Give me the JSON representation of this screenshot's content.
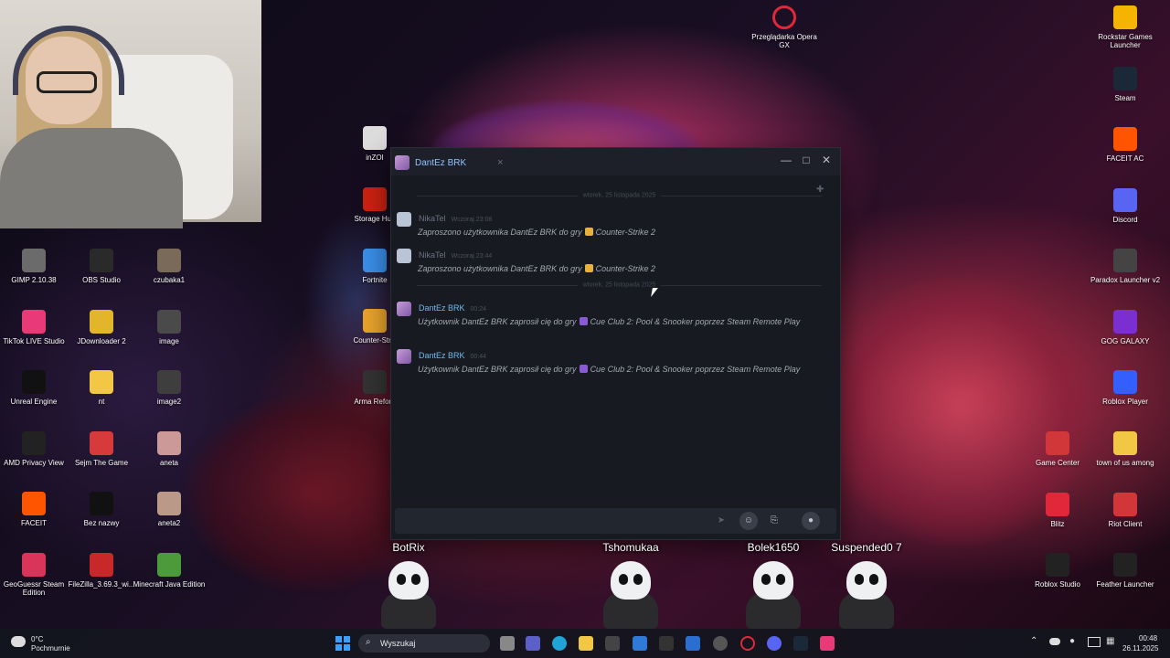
{
  "desktop": {
    "left_icons": [
      {
        "label": "GIMP 2.10.38",
        "icon": "gimp-icon",
        "color": "#6b6b6b"
      },
      {
        "label": "OBS Studio",
        "icon": "obs-icon",
        "color": "#2a2a2a"
      },
      {
        "label": "czubaka1",
        "icon": "image-file-icon",
        "color": "#7a6a5a"
      },
      {
        "label": "TikTok LIVE Studio",
        "icon": "tiktok-icon",
        "color": "#e83a76"
      },
      {
        "label": "JDownloader 2",
        "icon": "jdownloader-icon",
        "color": "#e2b62b"
      },
      {
        "label": "image",
        "icon": "image-file-icon",
        "color": "#4a4a4a"
      },
      {
        "label": "Unreal Engine",
        "icon": "unreal-icon",
        "color": "#111111"
      },
      {
        "label": "nt",
        "icon": "folder-icon",
        "color": "#f2c744"
      },
      {
        "label": "image2",
        "icon": "image-file-icon",
        "color": "#3e3e3e"
      },
      {
        "label": "AMD Privacy View",
        "icon": "amd-icon",
        "color": "#222222"
      },
      {
        "label": "Sejm The Game",
        "icon": "sejm-icon",
        "color": "#d63a3a"
      },
      {
        "label": "aneta",
        "icon": "image-file-icon",
        "color": "#c99"
      },
      {
        "label": "FACEIT",
        "icon": "faceit-icon",
        "color": "#ff5500"
      },
      {
        "label": "Bez nazwy",
        "icon": "image-file-icon",
        "color": "#111111"
      },
      {
        "label": "aneta2",
        "icon": "image-file-icon",
        "color": "#b98"
      },
      {
        "label": "GeoGuessr Steam Edition",
        "icon": "geoguessr-icon",
        "color": "#d9345a"
      },
      {
        "label": "FileZilla_3.69.3_wi...",
        "icon": "filezilla-icon",
        "color": "#c8282a"
      },
      {
        "label": "Minecraft Java Edition",
        "icon": "minecraft-icon",
        "color": "#4c9a3a"
      }
    ],
    "middle_icons": [
      {
        "label": "inZOI",
        "icon": "inzoi-icon",
        "color": "#ddd"
      },
      {
        "label": "Storage Hun",
        "icon": "storage-hunter-icon",
        "color": "#c21"
      },
      {
        "label": "Fortnite",
        "icon": "fortnite-icon",
        "color": "#3a8ee8"
      },
      {
        "label": "Counter-Strik",
        "icon": "cs-icon",
        "color": "#e8a42a"
      },
      {
        "label": "Arma Reforg",
        "icon": "arma-icon",
        "color": "#333"
      }
    ],
    "right_icons": [
      {
        "label": "Rockstar Games Launcher",
        "icon": "rockstar-icon",
        "color": "#f4b400"
      },
      {
        "label": "Steam",
        "icon": "steam-icon",
        "color": "#1b2838"
      },
      {
        "label": "FACEIT AC",
        "icon": "faceit-ac-icon",
        "color": "#ff5500"
      },
      {
        "label": "Discord",
        "icon": "discord-icon",
        "color": "#5865f2"
      },
      {
        "label": "Paradox Launcher v2",
        "icon": "paradox-icon",
        "color": "#444"
      },
      {
        "label": "GOG GALAXY",
        "icon": "gog-icon",
        "color": "#7b2fd0"
      },
      {
        "label": "Roblox Player",
        "icon": "roblox-icon",
        "color": "#335fff"
      },
      {
        "label": "town of us among",
        "icon": "folder-icon",
        "color": "#f2c744"
      },
      {
        "label": "Riot Client",
        "icon": "riot-icon",
        "color": "#d13639"
      },
      {
        "label": "Feather Launcher",
        "icon": "feather-icon",
        "color": "#222"
      }
    ],
    "right2_icons": [
      {
        "label": "Game Center",
        "icon": "game-center-icon",
        "color": "#d13639"
      },
      {
        "label": "Blitz",
        "icon": "blitz-icon",
        "color": "#e0283a"
      },
      {
        "label": "Roblox Studio",
        "icon": "roblox-studio-icon",
        "color": "#222"
      }
    ],
    "opera": {
      "label": "Przeglądarka Opera GX",
      "icon": "opera-gx-icon",
      "color": "#e0283a"
    }
  },
  "chat": {
    "tab_name": "DantEz BRK",
    "tab_close": "×",
    "window_buttons": [
      "—",
      "□",
      "✕"
    ],
    "date_divider_1": "wtorek, 25 listopada 2025",
    "date_divider_2": "wtorek, 25 listopada 2025",
    "messages": [
      {
        "sender": "NikaTel",
        "time": "Wczoraj 23:08",
        "text_pre": "Zaproszono użytkownika DantEz BRK do gry",
        "game": "Counter-Strike 2",
        "text_post": "",
        "name_color": "#6b7280",
        "game_color": "#e8b23a"
      },
      {
        "sender": "NikaTel",
        "time": "Wczoraj 23:44",
        "text_pre": "Zaproszono użytkownika DantEz BRK do gry",
        "game": "Counter-Strike 2",
        "text_post": "",
        "name_color": "#6b7280",
        "game_color": "#e8b23a"
      },
      {
        "sender": "DantEz BRK",
        "time": "00:24",
        "text_pre": "Użytkownik DantEz BRK zaprosił cię do gry",
        "game": "Cue Club 2: Pool & Snooker",
        "text_post": "poprzez Steam Remote Play",
        "name_color": "#6dbcf0",
        "game_color": "#8a5ad6"
      },
      {
        "sender": "DantEz BRK",
        "time": "00:44",
        "text_pre": "Użytkownik DantEz BRK zaprosił cię do gry",
        "game": "Cue Club 2: Pool & Snooker",
        "text_post": "poprzez Steam Remote Play",
        "name_color": "#6dbcf0",
        "game_color": "#8a5ad6"
      }
    ]
  },
  "overlay_players": [
    "BotRix",
    "Tshomukaa",
    "Bolek1650",
    "Suspended0 7"
  ],
  "taskbar": {
    "weather_temp": "0°C",
    "weather_desc": "Pochmurnie",
    "search_placeholder": "Wyszukaj",
    "time": "00:48",
    "date": "26.11.2025"
  }
}
